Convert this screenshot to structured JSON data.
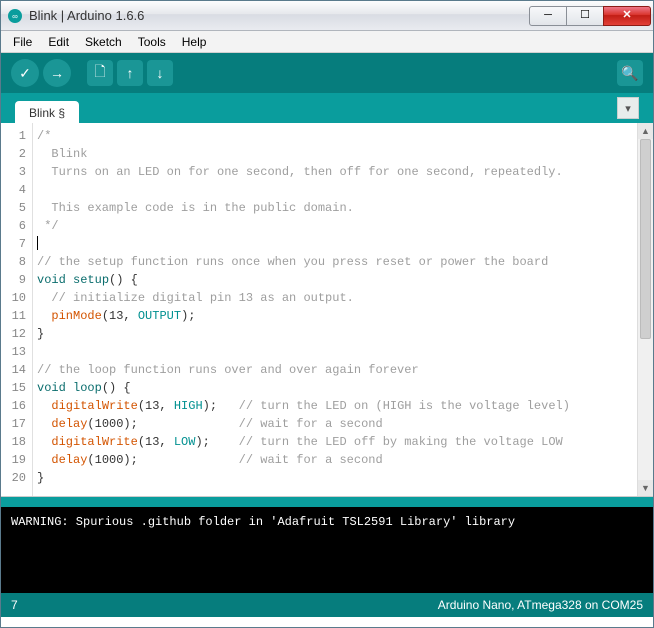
{
  "window": {
    "title": "Blink | Arduino 1.6.6"
  },
  "menu": {
    "items": [
      "File",
      "Edit",
      "Sketch",
      "Tools",
      "Help"
    ]
  },
  "toolbar": {
    "verify": "✓",
    "upload": "→",
    "new": "🗋",
    "open": "↑",
    "save": "↓",
    "serial": "🔍"
  },
  "tabs": {
    "active": "Blink §"
  },
  "editor": {
    "line_count": 20,
    "lines": [
      {
        "n": 1,
        "tokens": [
          {
            "t": "/*",
            "c": "comment"
          }
        ]
      },
      {
        "n": 2,
        "tokens": [
          {
            "t": "  Blink",
            "c": "comment"
          }
        ]
      },
      {
        "n": 3,
        "tokens": [
          {
            "t": "  Turns on an LED on for one second, then off for one second, repeatedly.",
            "c": "comment"
          }
        ]
      },
      {
        "n": 4,
        "tokens": [
          {
            "t": "",
            "c": "plain"
          }
        ]
      },
      {
        "n": 5,
        "tokens": [
          {
            "t": "  This example code is in the public domain.",
            "c": "comment"
          }
        ]
      },
      {
        "n": 6,
        "tokens": [
          {
            "t": " */",
            "c": "comment"
          }
        ]
      },
      {
        "n": 7,
        "tokens": [
          {
            "t": "",
            "c": "plain"
          }
        ],
        "cursor": true
      },
      {
        "n": 8,
        "tokens": [
          {
            "t": "// the setup function runs once when you press reset or power the board",
            "c": "comment"
          }
        ]
      },
      {
        "n": 9,
        "tokens": [
          {
            "t": "void",
            "c": "keyword"
          },
          {
            "t": " ",
            "c": "plain"
          },
          {
            "t": "setup",
            "c": "type"
          },
          {
            "t": "() {",
            "c": "plain"
          }
        ]
      },
      {
        "n": 10,
        "tokens": [
          {
            "t": "  ",
            "c": "plain"
          },
          {
            "t": "// initialize digital pin 13 as an output.",
            "c": "comment"
          }
        ]
      },
      {
        "n": 11,
        "tokens": [
          {
            "t": "  ",
            "c": "plain"
          },
          {
            "t": "pinMode",
            "c": "func"
          },
          {
            "t": "(13, ",
            "c": "plain"
          },
          {
            "t": "OUTPUT",
            "c": "const"
          },
          {
            "t": ");",
            "c": "plain"
          }
        ]
      },
      {
        "n": 12,
        "tokens": [
          {
            "t": "}",
            "c": "plain"
          }
        ]
      },
      {
        "n": 13,
        "tokens": [
          {
            "t": "",
            "c": "plain"
          }
        ]
      },
      {
        "n": 14,
        "tokens": [
          {
            "t": "// the loop function runs over and over again forever",
            "c": "comment"
          }
        ]
      },
      {
        "n": 15,
        "tokens": [
          {
            "t": "void",
            "c": "keyword"
          },
          {
            "t": " ",
            "c": "plain"
          },
          {
            "t": "loop",
            "c": "type"
          },
          {
            "t": "() {",
            "c": "plain"
          }
        ]
      },
      {
        "n": 16,
        "tokens": [
          {
            "t": "  ",
            "c": "plain"
          },
          {
            "t": "digitalWrite",
            "c": "func"
          },
          {
            "t": "(13, ",
            "c": "plain"
          },
          {
            "t": "HIGH",
            "c": "const"
          },
          {
            "t": ");   ",
            "c": "plain"
          },
          {
            "t": "// turn the LED on (HIGH is the voltage level)",
            "c": "comment"
          }
        ]
      },
      {
        "n": 17,
        "tokens": [
          {
            "t": "  ",
            "c": "plain"
          },
          {
            "t": "delay",
            "c": "func"
          },
          {
            "t": "(1000);              ",
            "c": "plain"
          },
          {
            "t": "// wait for a second",
            "c": "comment"
          }
        ]
      },
      {
        "n": 18,
        "tokens": [
          {
            "t": "  ",
            "c": "plain"
          },
          {
            "t": "digitalWrite",
            "c": "func"
          },
          {
            "t": "(13, ",
            "c": "plain"
          },
          {
            "t": "LOW",
            "c": "const"
          },
          {
            "t": ");    ",
            "c": "plain"
          },
          {
            "t": "// turn the LED off by making the voltage LOW",
            "c": "comment"
          }
        ]
      },
      {
        "n": 19,
        "tokens": [
          {
            "t": "  ",
            "c": "plain"
          },
          {
            "t": "delay",
            "c": "func"
          },
          {
            "t": "(1000);              ",
            "c": "plain"
          },
          {
            "t": "// wait for a second",
            "c": "comment"
          }
        ]
      },
      {
        "n": 20,
        "tokens": [
          {
            "t": "}",
            "c": "plain"
          }
        ]
      }
    ]
  },
  "console": {
    "text": "WARNING: Spurious .github folder in 'Adafruit TSL2591 Library' library"
  },
  "status": {
    "left": "7",
    "right": "Arduino Nano, ATmega328 on COM25"
  }
}
